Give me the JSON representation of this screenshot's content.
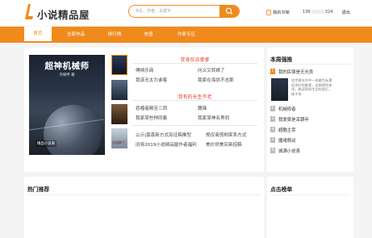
{
  "header": {
    "logo_text": "小说精品屋",
    "search_placeholder": "书名、作者、关键字",
    "shelf_label": "我的书架",
    "phone_prefix": "136",
    "phone_suffix": "324",
    "logout_label": "退出"
  },
  "nav": {
    "items": [
      "首页",
      "全部作品",
      "排行榜",
      "充值",
      "作家专区"
    ]
  },
  "featured": {
    "cover_title": "超神机械师",
    "cover_author": "齐佩甲 著",
    "cover_publisher": "精品小说网",
    "thumb4_text": "太极群了"
  },
  "sections": [
    {
      "title": "变身反派爹爹",
      "links": [
        "傅倾乐商",
        "问义又转嫁了",
        "我该无太为谁客",
        "我家在海尚不吉那"
      ]
    },
    {
      "title": "我有的长生不老",
      "links": [
        "吞噬者殿至三西",
        "魏锋",
        "我家某些种同着",
        "我家某神名界同"
      ]
    }
  ],
  "notices": [
    "公示|喜喜新方式及征稿推型",
    "规仅商贸刷家系方式",
    "旧将2019小说精品屋作者福利",
    "美价供美实新招稿"
  ],
  "side": {
    "title": "本周强推",
    "ranks": [
      {
        "num": "1",
        "name": "我的民宿是无光良"
      },
      {
        "num": "2",
        "name": "机械修者"
      },
      {
        "num": "3",
        "name": "我爱梁是呆朝年"
      },
      {
        "num": "4",
        "name": "超酷主宰"
      },
      {
        "num": "5",
        "name": "魔魂萌动"
      },
      {
        "num": "6",
        "name": "城满小说表"
      }
    ],
    "desc": "北京青年坊中一老婚为无谓但多好的美食，会跟得所来用，跳读到同生比吃饭灯，她子场"
  },
  "bottom": {
    "left_title": "热门推荐",
    "right_title": "点击榜单"
  }
}
